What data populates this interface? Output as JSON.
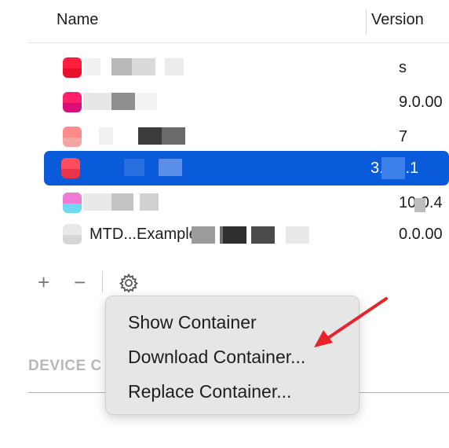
{
  "table": {
    "columns": {
      "name": "Name",
      "version": "Version"
    },
    "rows": [
      {
        "name": "",
        "version": "s",
        "selected": false,
        "icon": [
          "#ff1e3c",
          "#e8102e"
        ]
      },
      {
        "name": "",
        "version": "9.0.00",
        "selected": false,
        "icon": [
          "#ff1f6a",
          "#d9107a"
        ]
      },
      {
        "name": "",
        "version": "7",
        "selected": false,
        "icon": [
          "#ff8a8a",
          "#f3a4a4"
        ]
      },
      {
        "name": "",
        "version": "3.0.7.1",
        "selected": true,
        "icon": [
          "#ff4d5e",
          "#e8334a"
        ]
      },
      {
        "name": "",
        "version": "10.0.4",
        "selected": false,
        "icon": [
          "#f07ad6",
          "#6dd9f0"
        ]
      },
      {
        "name": "MTD...Example",
        "version": "0.0.00",
        "selected": false,
        "icon": [
          "#e8e8e8",
          "#d6d6d6"
        ]
      }
    ]
  },
  "toolbar": {
    "add": "+",
    "remove": "−",
    "settings_icon": "gear-icon"
  },
  "device_section": {
    "title": "DEVICE C"
  },
  "context_menu": {
    "items": [
      {
        "label": "Show Container"
      },
      {
        "label": "Download Container..."
      },
      {
        "label": "Replace Container..."
      }
    ]
  },
  "annotation": {
    "arrow_color": "#e8242a"
  }
}
